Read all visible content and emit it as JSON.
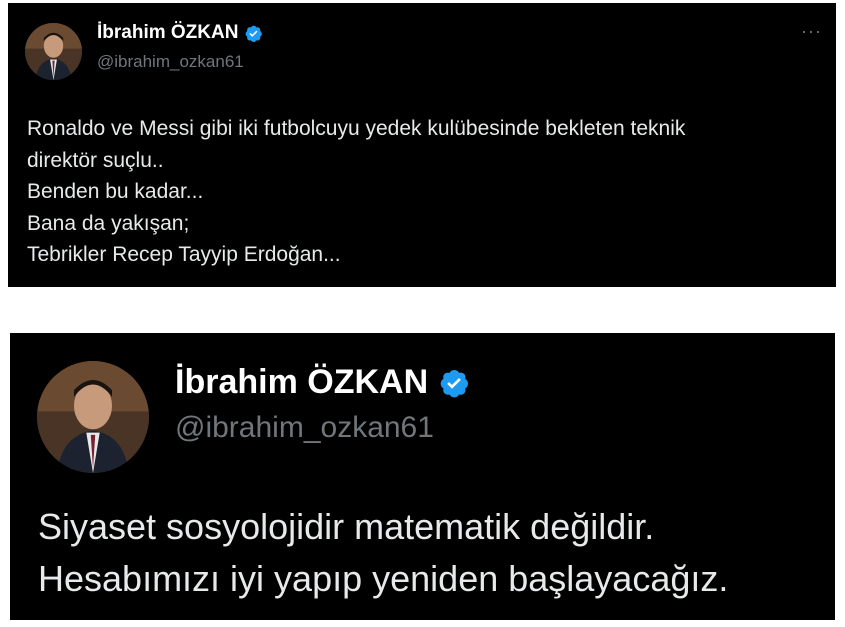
{
  "tweets": [
    {
      "author": {
        "name": "İbrahim ÖZKAN",
        "handle": "@ibrahim_ozkan61",
        "verified": true
      },
      "more_label": "···",
      "lines": [
        "Ronaldo ve Messi gibi iki futbolcuyu yedek kulübesinde bekleten teknik",
        "direktör suçlu..",
        "Benden bu kadar...",
        "Bana da yakışan;",
        "Tebrikler Recep Tayyip Erdoğan..."
      ]
    },
    {
      "author": {
        "name": "İbrahim ÖZKAN",
        "handle": "@ibrahim_ozkan61",
        "verified": true
      },
      "lines": [
        "Siyaset sosyolojidir matematik değildir.",
        "Hesabımızı iyi yapıp yeniden başlayacağız."
      ]
    }
  ],
  "colors": {
    "card_background": "#000000",
    "text": "#e7e9ea",
    "handle": "#71767b",
    "verified_badge": "#1d9bf0"
  },
  "icons": {
    "verified": "verified-badge-icon",
    "more": "more-options-icon"
  }
}
